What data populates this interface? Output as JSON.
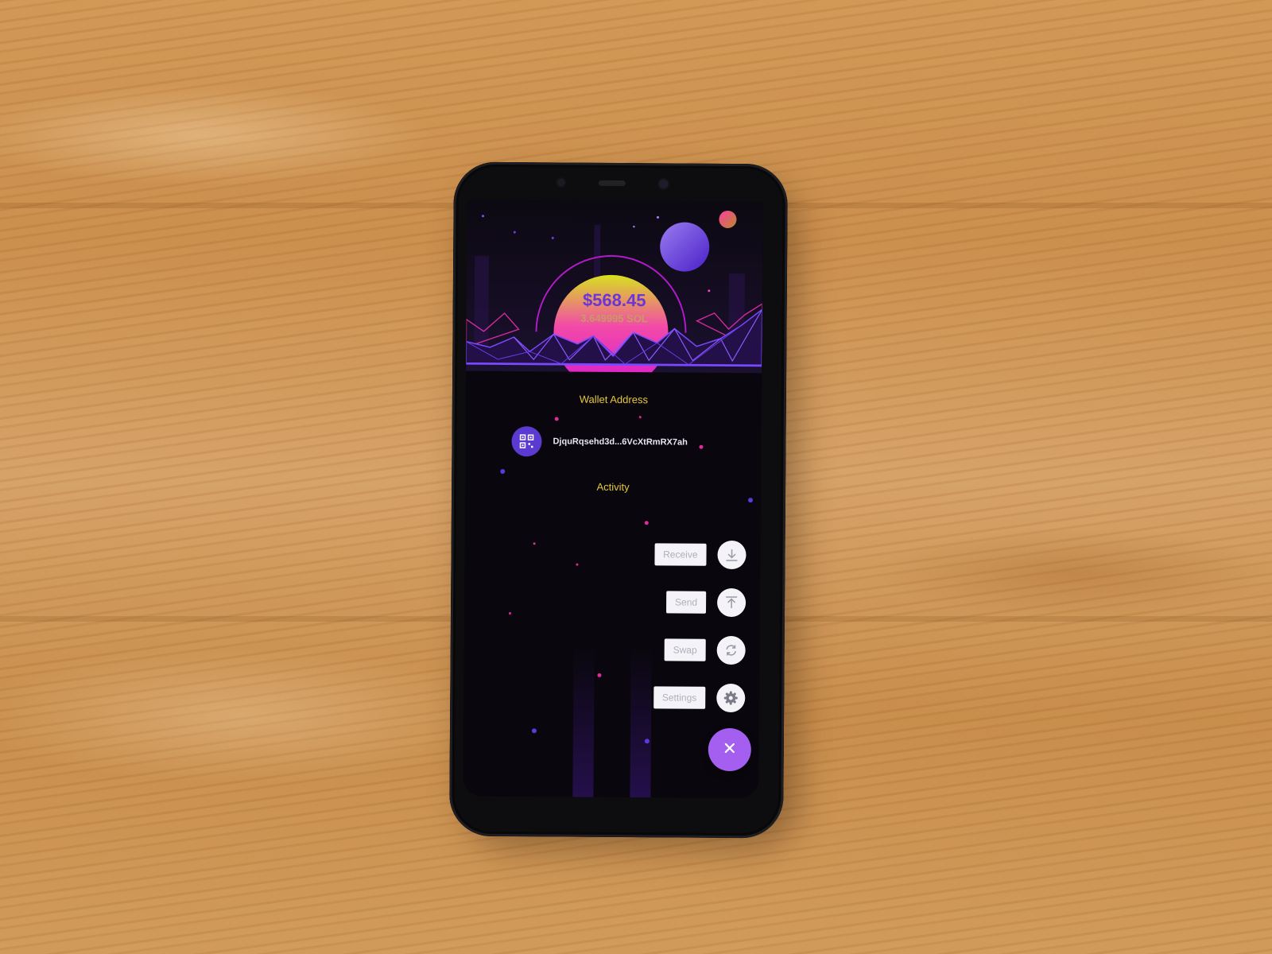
{
  "wallet": {
    "balance_usd": "$568.45",
    "balance_sol": "3.649995 SOL",
    "wallet_address_label": "Wallet Address",
    "address": "DjquRqsehd3d...6VcXtRmRX7ah",
    "activity_label": "Activity"
  },
  "actions": [
    {
      "label": "Receive",
      "icon": "download-icon"
    },
    {
      "label": "Send",
      "icon": "upload-icon"
    },
    {
      "label": "Swap",
      "icon": "refresh-icon"
    },
    {
      "label": "Settings",
      "icon": "gear-icon"
    }
  ],
  "fab": {
    "icon": "close-icon"
  },
  "colors": {
    "accent": "#a45ef0",
    "balance_text": "#6a36d8",
    "section_label": "#e6c83c",
    "sol_text": "#c99a64"
  }
}
